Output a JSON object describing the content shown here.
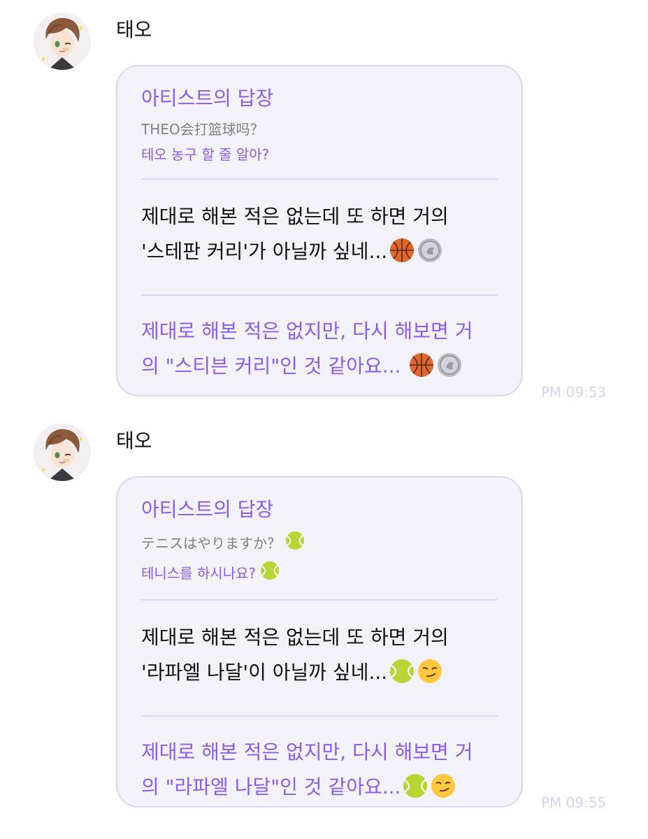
{
  "messages": [
    {
      "sender": "태오",
      "reply_header": "아티스트의 답장",
      "question_original": "THEO会打篮球吗？",
      "question_translated": "테오 농구 할 줄 알아?",
      "answer_line1": "제대로 해본 적은 없는데 또 하면 거의",
      "answer_line2": "'스테판 커리'가 아닐까 싶네...",
      "answer_emojis": [
        "basketball-icon",
        "coin-icon"
      ],
      "translation_line1": "제대로 해본 적은 없지만, 다시 해보면 거",
      "translation_line2": "의 \"스티븐 커리\"인 것 같아요... ",
      "translation_emojis": [
        "basketball-icon",
        "coin-icon"
      ],
      "time": "PM 09:53"
    },
    {
      "sender": "태오",
      "reply_header": "아티스트의 답장",
      "question_original": "テニスはやりますか？",
      "question_original_emoji": "tennis-ball-icon",
      "question_translated": "테니스를 하시나요? ",
      "question_translated_emoji": "tennis-ball-icon",
      "answer_line1": "제대로 해본 적은 없는데 또 하면 거의",
      "answer_line2": "'라파엘 나달'이 아닐까 싶네...",
      "answer_emojis": [
        "tennis-ball-icon",
        "smirk-face-icon"
      ],
      "translation_line1": "제대로 해본 적은 없지만, 다시 해보면 거",
      "translation_line2": "의 \"라파엘 나달\"인 것 같아요...",
      "translation_emojis": [
        "tennis-ball-icon",
        "smirk-face-icon"
      ],
      "time": "PM 09:55"
    }
  ],
  "colors": {
    "accent_purple": "#8b5cf0",
    "bubble_bg": "#f3f2f8",
    "bubble_border": "#dcd5f6",
    "time_text": "#d9d0f5",
    "muted_text": "#7f7f87"
  }
}
